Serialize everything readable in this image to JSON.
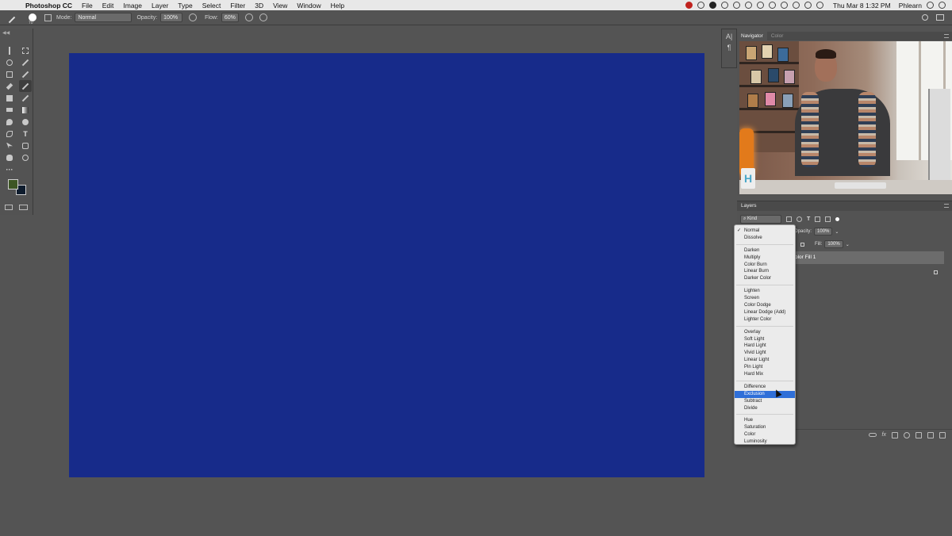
{
  "menubar": {
    "apple_icon": "apple-logo",
    "items": [
      "Photoshop CC",
      "File",
      "Edit",
      "Image",
      "Layer",
      "Type",
      "Select",
      "Filter",
      "3D",
      "View",
      "Window",
      "Help"
    ],
    "clock": "Thu Mar 8  1:32 PM",
    "user": "Phlearn"
  },
  "options_bar": {
    "brush_size": "70",
    "mode_label": "Mode:",
    "mode_value": "Normal",
    "opacity_label": "Opacity:",
    "opacity_value": "100%",
    "flow_label": "Flow:",
    "flow_value": "60%"
  },
  "tools": {
    "foreground_color": "#3d5624",
    "background_color": "#0f1d2e"
  },
  "canvas": {
    "fill_color": "#172b8a"
  },
  "navigator": {
    "tabs": [
      "Navigator",
      "Color"
    ],
    "active_tab": "Navigator"
  },
  "layers": {
    "title": "Layers",
    "kind_label": "Kind",
    "opacity_label": "Opacity:",
    "opacity_value": "100%",
    "fill_label": "Fill:",
    "fill_value": "100%",
    "selected_layer_name": "olor Fill 1"
  },
  "blend_menu": {
    "groups": [
      [
        "Normal",
        "Dissolve"
      ],
      [
        "Darken",
        "Multiply",
        "Color Burn",
        "Linear Burn",
        "Darker Color"
      ],
      [
        "Lighten",
        "Screen",
        "Color Dodge",
        "Linear Dodge (Add)",
        "Lighter Color"
      ],
      [
        "Overlay",
        "Soft Light",
        "Hard Light",
        "Vivid Light",
        "Linear Light",
        "Pin Light",
        "Hard Mix"
      ],
      [
        "Difference",
        "Exclusion",
        "Subtract",
        "Divide"
      ],
      [
        "Hue",
        "Saturation",
        "Color",
        "Luminosity"
      ]
    ],
    "checked": "Normal",
    "highlighted": "Exclusion",
    "highlight_color": "#2f6fd8"
  }
}
